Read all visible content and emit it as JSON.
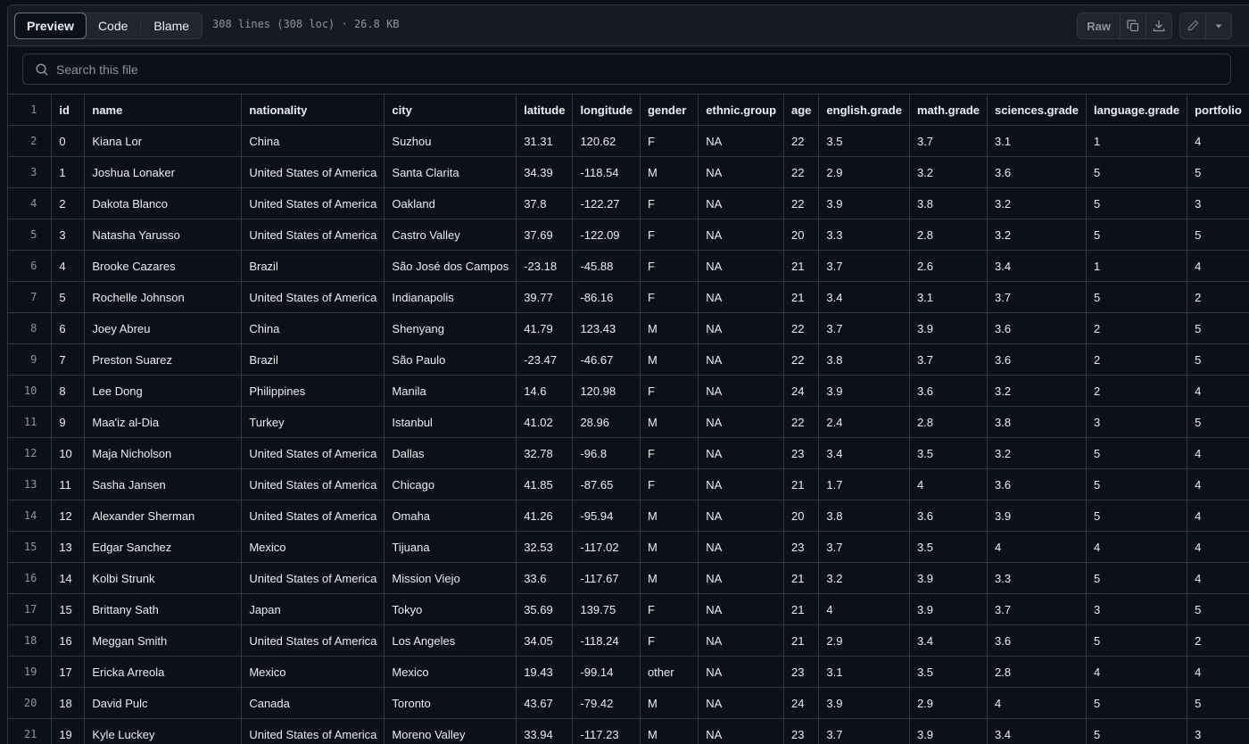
{
  "toolbar": {
    "tabs": [
      "Preview",
      "Code",
      "Blame"
    ],
    "file_meta": "308 lines (308 loc) · 26.8 KB",
    "raw_label": "Raw",
    "icons": [
      "copy-icon",
      "download-icon",
      "pencil-icon",
      "triangle-down-icon"
    ]
  },
  "search": {
    "placeholder": "Search this file"
  },
  "table": {
    "columns": [
      "id",
      "name",
      "nationality",
      "city",
      "latitude",
      "longitude",
      "gender",
      "ethnic.group",
      "age",
      "english.grade",
      "math.grade",
      "sciences.grade",
      "language.grade",
      "portfolio"
    ],
    "rows": [
      [
        "0",
        "Kiana Lor",
        "China",
        "Suzhou",
        "31.31",
        "120.62",
        "F",
        "NA",
        "22",
        "3.5",
        "3.7",
        "3.1",
        "1",
        "4"
      ],
      [
        "1",
        "Joshua Lonaker",
        "United States of America",
        "Santa Clarita",
        "34.39",
        "-118.54",
        "M",
        "NA",
        "22",
        "2.9",
        "3.2",
        "3.6",
        "5",
        "5"
      ],
      [
        "2",
        "Dakota Blanco",
        "United States of America",
        "Oakland",
        "37.8",
        "-122.27",
        "F",
        "NA",
        "22",
        "3.9",
        "3.8",
        "3.2",
        "5",
        "3"
      ],
      [
        "3",
        "Natasha Yarusso",
        "United States of America",
        "Castro Valley",
        "37.69",
        "-122.09",
        "F",
        "NA",
        "20",
        "3.3",
        "2.8",
        "3.2",
        "5",
        "5"
      ],
      [
        "4",
        "Brooke Cazares",
        "Brazil",
        "São José dos Campos",
        "-23.18",
        "-45.88",
        "F",
        "NA",
        "21",
        "3.7",
        "2.6",
        "3.4",
        "1",
        "4"
      ],
      [
        "5",
        "Rochelle Johnson",
        "United States of America",
        "Indianapolis",
        "39.77",
        "-86.16",
        "F",
        "NA",
        "21",
        "3.4",
        "3.1",
        "3.7",
        "5",
        "2"
      ],
      [
        "6",
        "Joey Abreu",
        "China",
        "Shenyang",
        "41.79",
        "123.43",
        "M",
        "NA",
        "22",
        "3.7",
        "3.9",
        "3.6",
        "2",
        "5"
      ],
      [
        "7",
        "Preston Suarez",
        "Brazil",
        "São Paulo",
        "-23.47",
        "-46.67",
        "M",
        "NA",
        "22",
        "3.8",
        "3.7",
        "3.6",
        "2",
        "5"
      ],
      [
        "8",
        "Lee Dong",
        "Philippines",
        "Manila",
        "14.6",
        "120.98",
        "F",
        "NA",
        "24",
        "3.9",
        "3.6",
        "3.2",
        "2",
        "4"
      ],
      [
        "9",
        "Maa'iz al-Dia",
        "Turkey",
        "Istanbul",
        "41.02",
        "28.96",
        "M",
        "NA",
        "22",
        "2.4",
        "2.8",
        "3.8",
        "3",
        "5"
      ],
      [
        "10",
        "Maja Nicholson",
        "United States of America",
        "Dallas",
        "32.78",
        "-96.8",
        "F",
        "NA",
        "23",
        "3.4",
        "3.5",
        "3.2",
        "5",
        "4"
      ],
      [
        "11",
        "Sasha Jansen",
        "United States of America",
        "Chicago",
        "41.85",
        "-87.65",
        "F",
        "NA",
        "21",
        "1.7",
        "4",
        "3.6",
        "5",
        "4"
      ],
      [
        "12",
        "Alexander Sherman",
        "United States of America",
        "Omaha",
        "41.26",
        "-95.94",
        "M",
        "NA",
        "20",
        "3.8",
        "3.6",
        "3.9",
        "5",
        "4"
      ],
      [
        "13",
        "Edgar Sanchez",
        "Mexico",
        "Tijuana",
        "32.53",
        "-117.02",
        "M",
        "NA",
        "23",
        "3.7",
        "3.5",
        "4",
        "4",
        "4"
      ],
      [
        "14",
        "Kolbi Strunk",
        "United States of America",
        "Mission Viejo",
        "33.6",
        "-117.67",
        "M",
        "NA",
        "21",
        "3.2",
        "3.9",
        "3.3",
        "5",
        "4"
      ],
      [
        "15",
        "Brittany Sath",
        "Japan",
        "Tokyo",
        "35.69",
        "139.75",
        "F",
        "NA",
        "21",
        "4",
        "3.9",
        "3.7",
        "3",
        "5"
      ],
      [
        "16",
        "Meggan Smith",
        "United States of America",
        "Los Angeles",
        "34.05",
        "-118.24",
        "F",
        "NA",
        "21",
        "2.9",
        "3.4",
        "3.6",
        "5",
        "2"
      ],
      [
        "17",
        "Ericka Arreola",
        "Mexico",
        "Mexico",
        "19.43",
        "-99.14",
        "other",
        "NA",
        "23",
        "3.1",
        "3.5",
        "2.8",
        "4",
        "4"
      ],
      [
        "18",
        "David Pulc",
        "Canada",
        "Toronto",
        "43.67",
        "-79.42",
        "M",
        "NA",
        "24",
        "3.9",
        "2.9",
        "4",
        "5",
        "5"
      ],
      [
        "19",
        "Kyle Luckey",
        "United States of America",
        "Moreno Valley",
        "33.94",
        "-117.23",
        "M",
        "NA",
        "23",
        "3.7",
        "3.9",
        "3.4",
        "5",
        "3"
      ]
    ]
  }
}
